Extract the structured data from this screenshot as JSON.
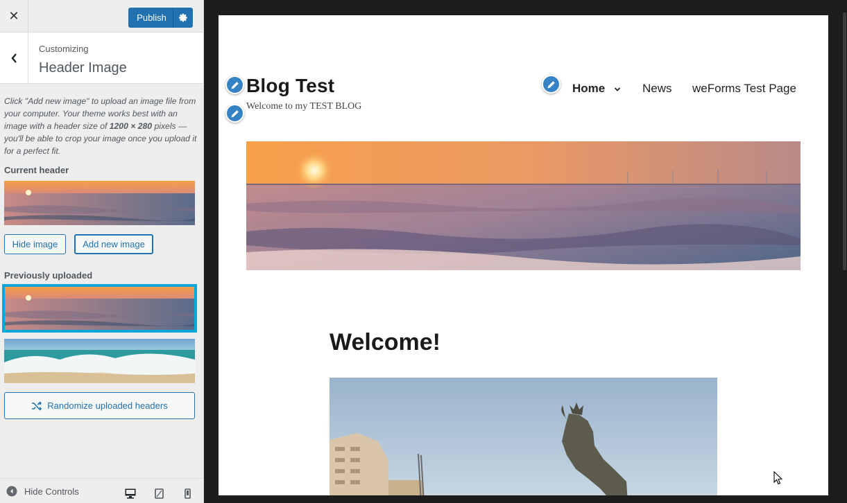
{
  "customizer": {
    "close_icon": "close-icon",
    "publish_label": "Publish",
    "settings_icon": "gear-icon",
    "back_icon": "chevron-left-icon",
    "breadcrumb": "Customizing",
    "section_title": "Header Image",
    "description_1": "Click \"Add new image\" to upload an image file from your computer. Your theme works best with an image with a header size of ",
    "description_size": "1200 × 280",
    "description_2": " pixels — you'll be able to crop your image once you upload it for a perfect fit.",
    "current_header_label": "Current header",
    "hide_image_label": "Hide image",
    "add_new_image_label": "Add new image",
    "previously_uploaded_label": "Previously uploaded",
    "randomize_label": "Randomize uploaded headers",
    "hide_controls_label": "Hide Controls",
    "devices": [
      "desktop-icon",
      "tablet-icon",
      "mobile-icon"
    ]
  },
  "preview": {
    "site_title": "Blog Test",
    "tagline": "Welcome to my TEST BLOG",
    "menu": [
      {
        "label": "Home",
        "active": true,
        "has_submenu": true
      },
      {
        "label": "News",
        "active": false
      },
      {
        "label": "weForms Test Page",
        "active": false
      }
    ],
    "post_title": "Welcome!"
  },
  "colors": {
    "accent": "#2271b1",
    "selected_outline": "#0ea5d8",
    "edit_shortcut": "#3582c4"
  }
}
